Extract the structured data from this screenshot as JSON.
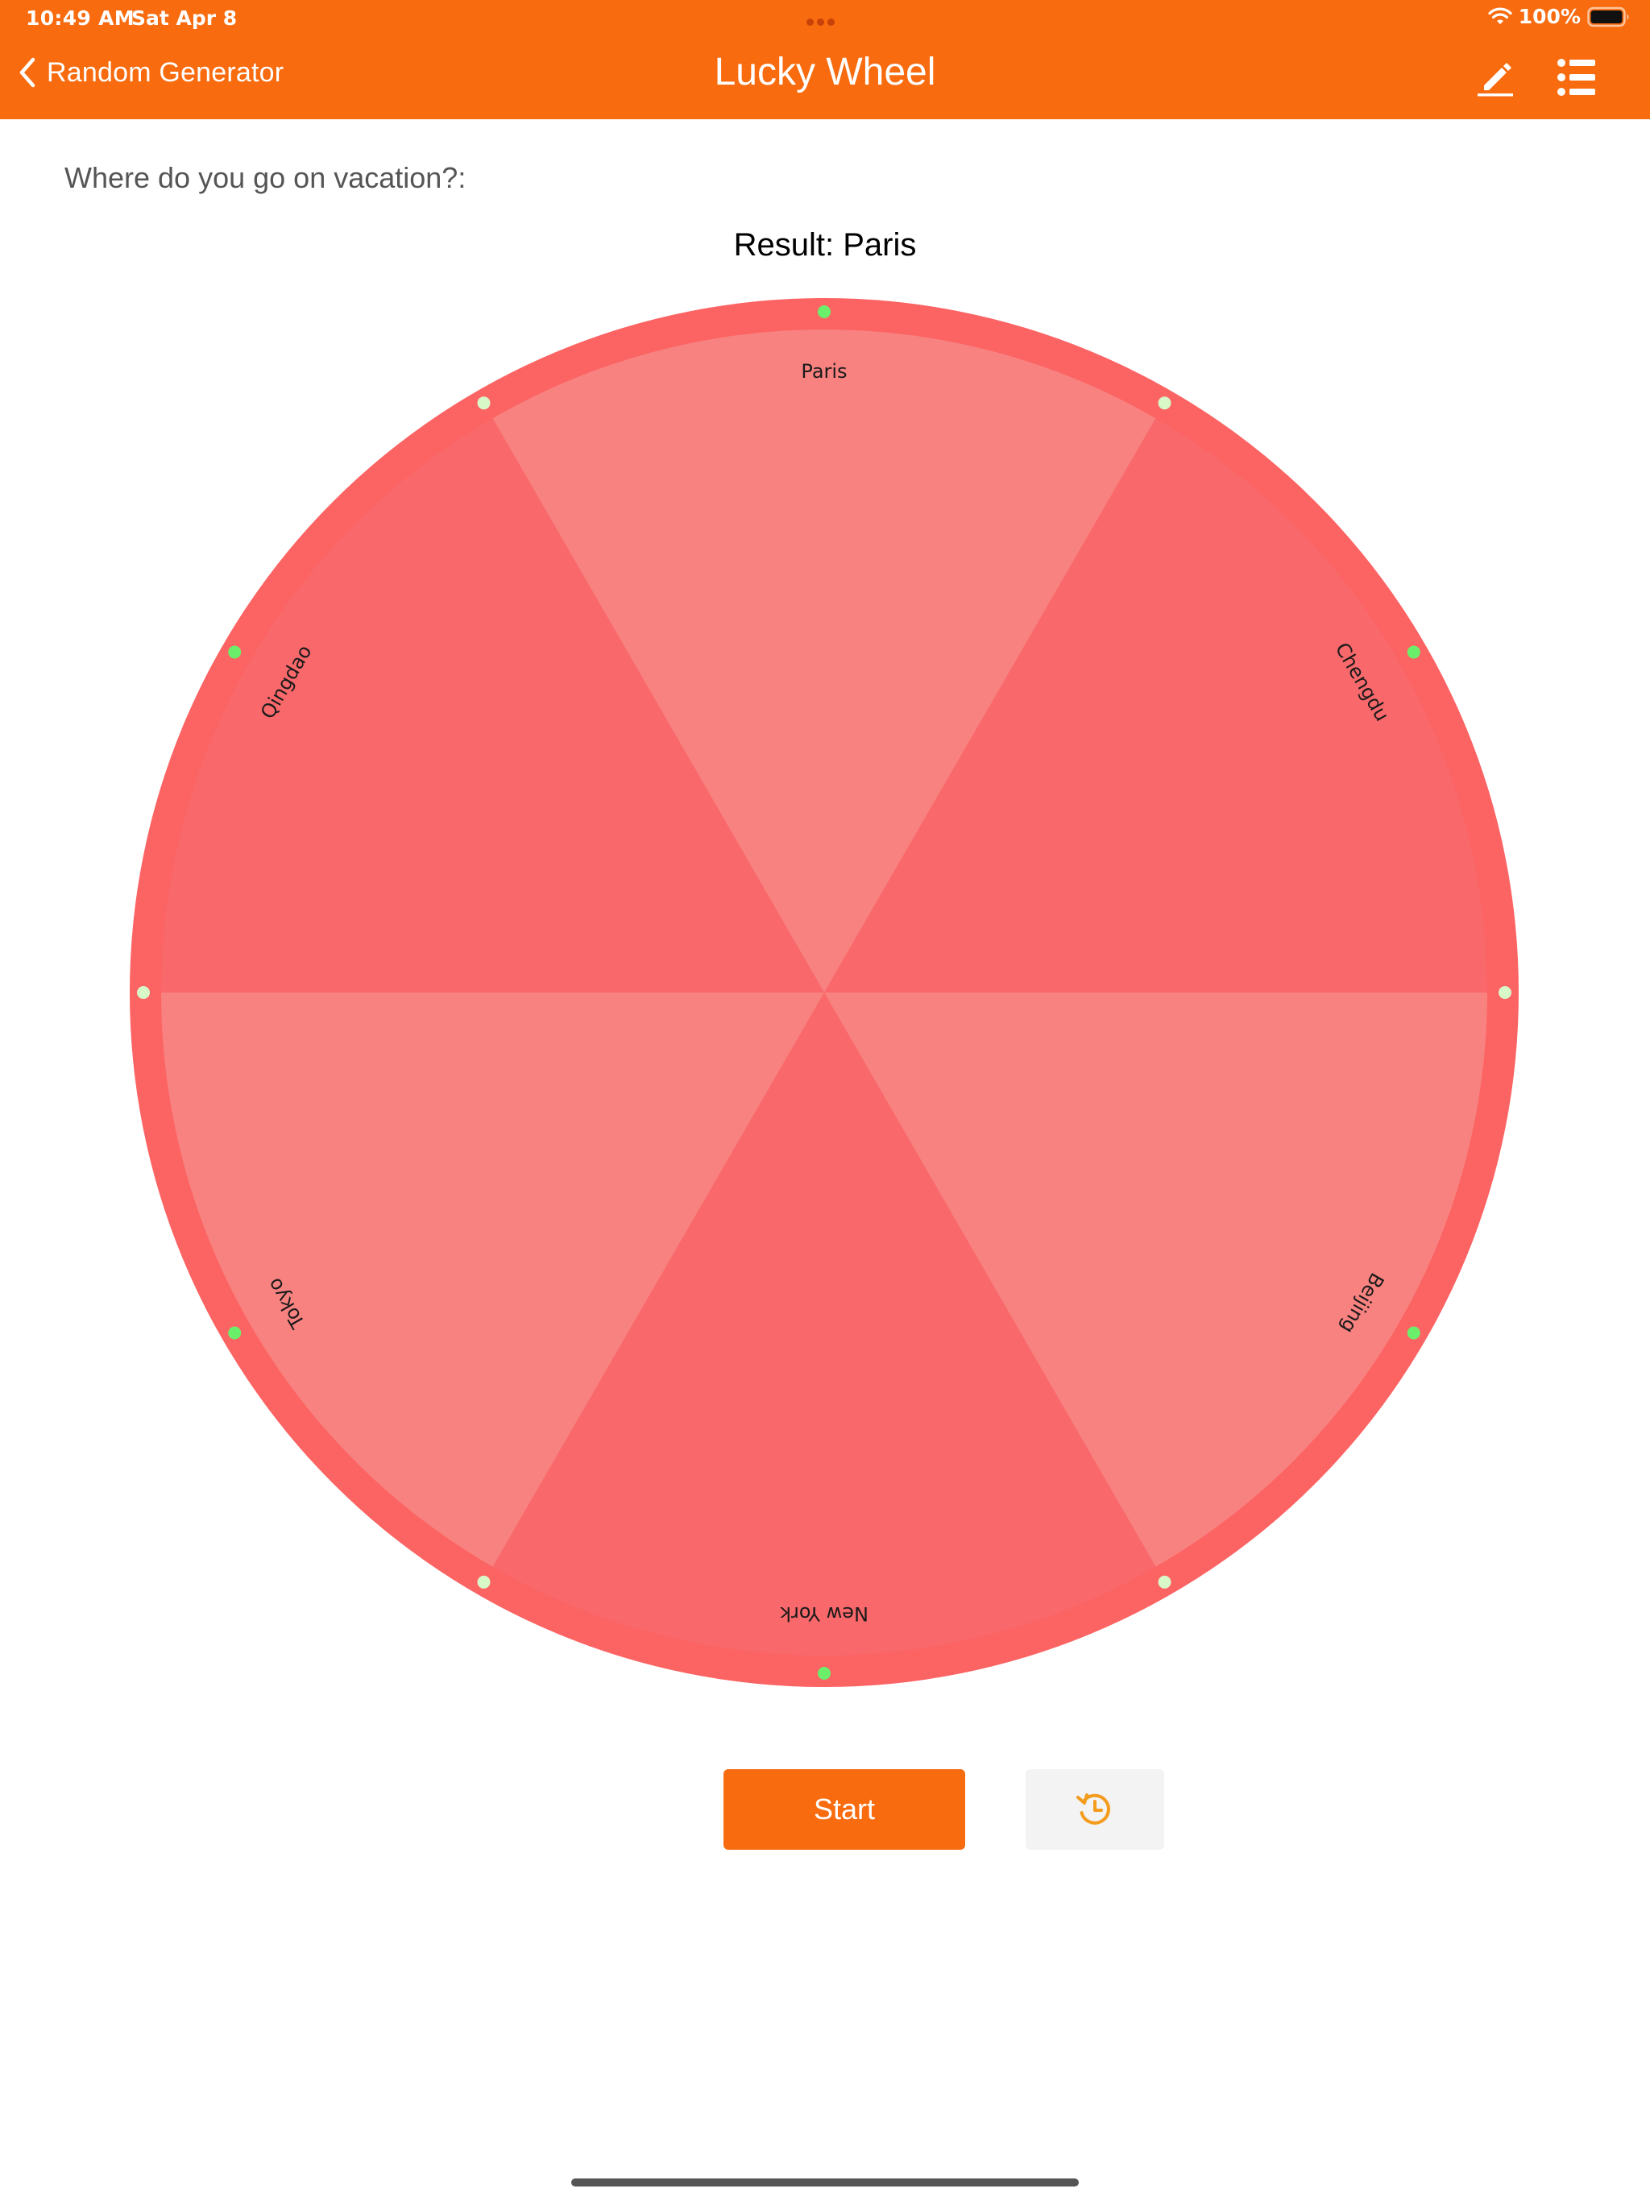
{
  "status_bar": {
    "time": "10:49 AM",
    "date": "Sat Apr 8",
    "battery": "100%"
  },
  "nav": {
    "back_label": "Random Generator",
    "title": "Lucky Wheel",
    "icons": {
      "back": "chevron-left-icon",
      "edit": "pencil-icon",
      "list": "list-icon"
    }
  },
  "question": "Where do you go on vacation?:",
  "result_text": "Result: Paris",
  "wheel": {
    "segments": [
      {
        "label": "Paris"
      },
      {
        "label": "Chengdu"
      },
      {
        "label": "Beijing"
      },
      {
        "label": "New York"
      },
      {
        "label": "Tokyo"
      },
      {
        "label": "Qingdao"
      }
    ],
    "colors": {
      "rim": "#FC6363",
      "segment_light": "#F88280",
      "segment_dark": "#F9686B",
      "dot_green": "#6BEF6B",
      "dot_pale": "#D8F8C8",
      "label": "#1A1A1A"
    }
  },
  "buttons": {
    "start": "Start",
    "history_icon": "history-icon"
  },
  "colors": {
    "accent": "#F86B0E",
    "history_icon": "#F39C1E"
  }
}
